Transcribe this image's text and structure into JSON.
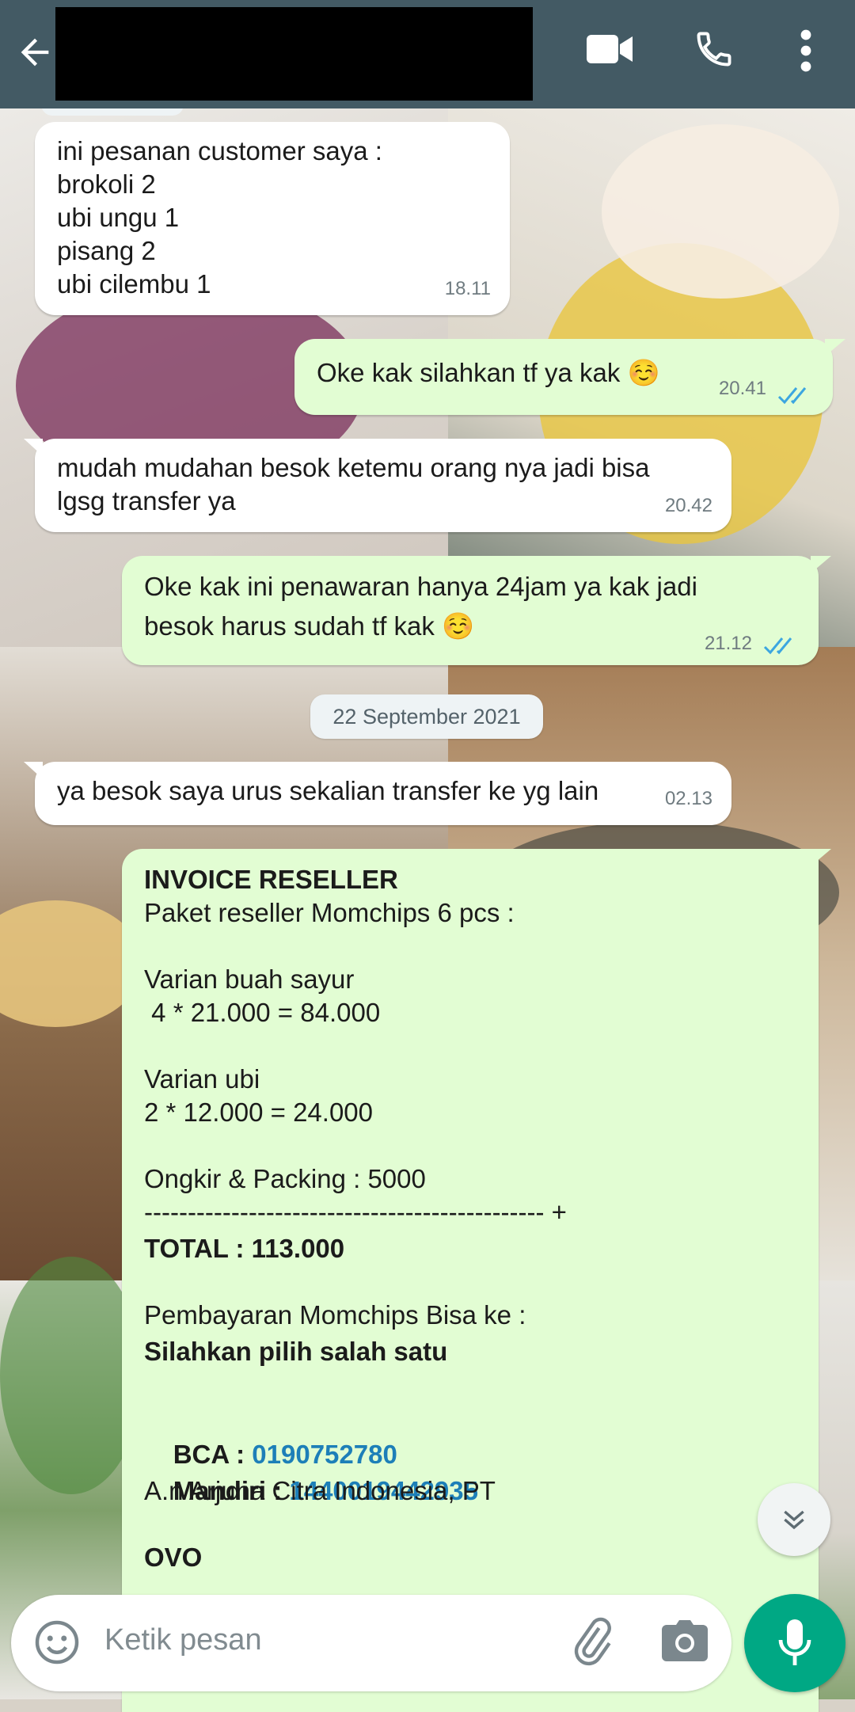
{
  "header": {
    "back_icon": "arrow-left-icon",
    "contact_name": "",
    "video_icon": "video-camera-icon",
    "call_icon": "phone-icon",
    "menu_icon": "more-vertical-icon",
    "background": "#435a64"
  },
  "messages": [
    {
      "direction": "in",
      "text": "ini pesanan customer saya :\nbrokoli 2\nubi ungu 1\npisang 2\nubi cilembu 1",
      "time": "18.11"
    },
    {
      "direction": "out",
      "text": "Oke kak silahkan tf ya kak ☺️",
      "time": "20.41",
      "status": "read"
    },
    {
      "direction": "in",
      "text": "mudah mudahan besok ketemu orang nya jadi bisa\nlgsg transfer ya",
      "time": "20.42"
    },
    {
      "direction": "out",
      "text": "Oke kak ini penawaran hanya 24jam ya kak jadi\nbesok harus sudah tf kak ☺️",
      "time": "21.12",
      "status": "read"
    },
    {
      "direction": "in",
      "text": "ya besok saya urus sekalian transfer ke yg lain",
      "time": "02.13"
    }
  ],
  "date_divider": "22 September 2021",
  "invoice": {
    "title": "INVOICE RESELLER",
    "package": "Paket reseller Momchips 6 pcs :",
    "variant1_label": "Varian buah sayur",
    "variant1_calc": " 4 * 21.000 = 84.000",
    "variant2_label": "Varian ubi",
    "variant2_calc": "2 * 12.000 = 24.000",
    "shipping": "Ongkir & Packing : 5000",
    "separator": "---------------------------------------------- +",
    "total": "TOTAL : 113.000",
    "payment_intro": "Pembayaran Momchips Bisa ke :",
    "choose": "Silahkan pilih salah satu",
    "bca_label": "BCA : ",
    "bca_number": "0190752780",
    "mandiri_label": "Mandiri : ",
    "mandiri_number": "1440019442935",
    "account_name": "A.n Arjuna Citra Indonesia, PT",
    "ovo_label": "OVO"
  },
  "scroll_down_icon": "double-chevron-down-icon",
  "composer": {
    "emoji_icon": "emoji-icon",
    "placeholder": "Ketik pesan",
    "attach_icon": "paperclip-icon",
    "camera_icon": "camera-icon",
    "mic_icon": "microphone-icon"
  },
  "colors": {
    "incoming_bubble": "#ffffff",
    "outgoing_bubble": "#e2fdd3",
    "read_ticks": "#3ca6e0",
    "link": "#1d7fb8",
    "mic_button": "#00a884"
  }
}
